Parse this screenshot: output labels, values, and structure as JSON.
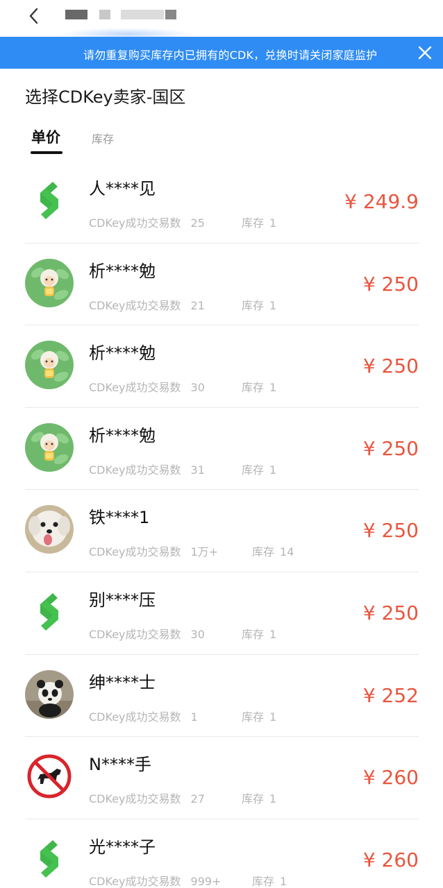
{
  "header": {
    "back_icon": "chevron-left-icon"
  },
  "notice": {
    "text": "请勿重复购买库存内已拥有的CDK，兑换时请关闭家庭监护",
    "close_icon": "close-icon"
  },
  "page": {
    "title": "选择CDKey卖家-国区"
  },
  "tabs": [
    {
      "label": "单价",
      "active": true
    },
    {
      "label": "库存",
      "active": false
    }
  ],
  "colors": {
    "banner": "#2f8cf4",
    "price": "#e8553e",
    "meta": "#b5b5b5"
  },
  "sellers": [
    {
      "name": "人****见",
      "trade_label": "CDKey成功交易数",
      "trades": "25",
      "stock_label": "库存",
      "stock": "1",
      "price": "¥ 249.9",
      "avatar": "green-logo"
    },
    {
      "name": "析****勉",
      "trade_label": "CDKey成功交易数",
      "trades": "21",
      "stock_label": "库存",
      "stock": "1",
      "price": "¥ 250",
      "avatar": "cartoon-sheep"
    },
    {
      "name": "析****勉",
      "trade_label": "CDKey成功交易数",
      "trades": "30",
      "stock_label": "库存",
      "stock": "1",
      "price": "¥ 250",
      "avatar": "cartoon-sheep"
    },
    {
      "name": "析****勉",
      "trade_label": "CDKey成功交易数",
      "trades": "31",
      "stock_label": "库存",
      "stock": "1",
      "price": "¥ 250",
      "avatar": "cartoon-sheep"
    },
    {
      "name": "铁****1",
      "trade_label": "CDKey成功交易数",
      "trades": "1万+",
      "stock_label": "库存",
      "stock": "14",
      "price": "¥ 250",
      "avatar": "white-dog"
    },
    {
      "name": "别****压",
      "trade_label": "CDKey成功交易数",
      "trades": "30",
      "stock_label": "库存",
      "stock": "1",
      "price": "¥ 250",
      "avatar": "green-logo"
    },
    {
      "name": "绅****士",
      "trade_label": "CDKey成功交易数",
      "trades": "1",
      "stock_label": "库存",
      "stock": "1",
      "price": "¥ 252",
      "avatar": "panda"
    },
    {
      "name": "N****手",
      "trade_label": "CDKey成功交易数",
      "trades": "27",
      "stock_label": "库存",
      "stock": "1",
      "price": "¥ 260",
      "avatar": "no-dog-sign"
    },
    {
      "name": "光****子",
      "trade_label": "CDKey成功交易数",
      "trades": "999+",
      "stock_label": "库存",
      "stock": "1",
      "price": "¥ 260",
      "avatar": "green-logo"
    }
  ]
}
